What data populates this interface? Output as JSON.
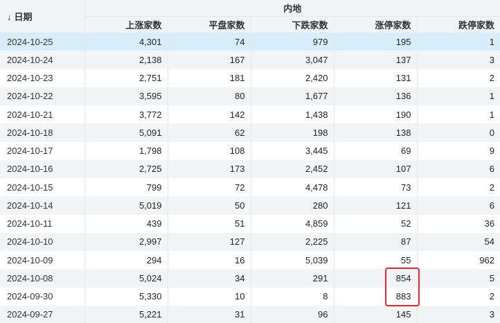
{
  "header": {
    "sort_icon": "↓",
    "date_label": "日期",
    "group_label": "内地",
    "columns": [
      "上涨家数",
      "平盘家数",
      "下跌家数",
      "涨停家数",
      "跌停家数"
    ]
  },
  "rows": [
    {
      "date": "2024-10-25",
      "up": "4,301",
      "flat": "74",
      "down": "979",
      "limit_up": "195",
      "limit_down": "1"
    },
    {
      "date": "2024-10-24",
      "up": "2,138",
      "flat": "167",
      "down": "3,047",
      "limit_up": "137",
      "limit_down": "3"
    },
    {
      "date": "2024-10-23",
      "up": "2,751",
      "flat": "181",
      "down": "2,420",
      "limit_up": "131",
      "limit_down": "2"
    },
    {
      "date": "2024-10-22",
      "up": "3,595",
      "flat": "80",
      "down": "1,677",
      "limit_up": "136",
      "limit_down": "1"
    },
    {
      "date": "2024-10-21",
      "up": "3,772",
      "flat": "142",
      "down": "1,438",
      "limit_up": "190",
      "limit_down": "1"
    },
    {
      "date": "2024-10-18",
      "up": "5,091",
      "flat": "62",
      "down": "198",
      "limit_up": "138",
      "limit_down": "0"
    },
    {
      "date": "2024-10-17",
      "up": "1,798",
      "flat": "108",
      "down": "3,445",
      "limit_up": "69",
      "limit_down": "9"
    },
    {
      "date": "2024-10-16",
      "up": "2,725",
      "flat": "173",
      "down": "2,452",
      "limit_up": "107",
      "limit_down": "6"
    },
    {
      "date": "2024-10-15",
      "up": "799",
      "flat": "72",
      "down": "4,478",
      "limit_up": "73",
      "limit_down": "2"
    },
    {
      "date": "2024-10-14",
      "up": "5,019",
      "flat": "50",
      "down": "280",
      "limit_up": "121",
      "limit_down": "6"
    },
    {
      "date": "2024-10-11",
      "up": "439",
      "flat": "51",
      "down": "4,859",
      "limit_up": "52",
      "limit_down": "36"
    },
    {
      "date": "2024-10-10",
      "up": "2,997",
      "flat": "127",
      "down": "2,225",
      "limit_up": "87",
      "limit_down": "54"
    },
    {
      "date": "2024-10-09",
      "up": "294",
      "flat": "16",
      "down": "5,039",
      "limit_up": "55",
      "limit_down": "962"
    },
    {
      "date": "2024-10-08",
      "up": "5,024",
      "flat": "34",
      "down": "291",
      "limit_up": "854",
      "limit_down": "5"
    },
    {
      "date": "2024-09-30",
      "up": "5,330",
      "flat": "10",
      "down": "8",
      "limit_up": "883",
      "limit_down": "2"
    },
    {
      "date": "2024-09-27",
      "up": "5,221",
      "flat": "31",
      "down": "96",
      "limit_up": "145",
      "limit_down": "3"
    }
  ],
  "colors": {
    "header_bg": "#f2f4f7",
    "row_alt_bg": "#f3f4f6",
    "selected_row_bg": "#d7eefa",
    "highlight_border": "#e8292c"
  }
}
